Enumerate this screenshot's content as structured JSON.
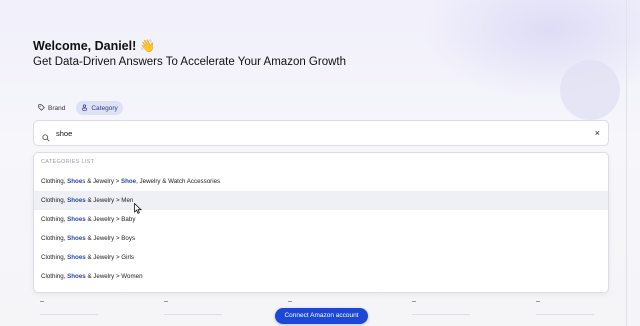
{
  "header": {
    "welcome": "Welcome, Daniel! 👋",
    "subtitle": "Get Data-Driven Answers To Accelerate Your Amazon Growth"
  },
  "tabs": [
    {
      "label": "Brand",
      "icon": "tag-icon",
      "active": false
    },
    {
      "label": "Category",
      "icon": "category-icon",
      "active": true
    }
  ],
  "search": {
    "value": "shoe",
    "placeholder": "",
    "clear_label": "×"
  },
  "dropdown": {
    "header": "CATEGORIES LIST",
    "items": [
      {
        "prefix": "Clothing, ",
        "match": "Shoe",
        "suffix": "s & Jewelry > ",
        "match2": "Shoe",
        "suffix2": ", Jewelry & Watch Accessories"
      },
      {
        "prefix": "Clothing, ",
        "match": "Shoes",
        "suffix": " & Jewelry > Men"
      },
      {
        "prefix": "Clothing, ",
        "match": "Shoes",
        "suffix": " & Jewelry > Baby"
      },
      {
        "prefix": "Clothing, ",
        "match": "Shoes",
        "suffix": " & Jewelry > Boys"
      },
      {
        "prefix": "Clothing, ",
        "match": "Shoes",
        "suffix": " & Jewelry > Girls"
      },
      {
        "prefix": "Clothing, ",
        "match": "Shoes",
        "suffix": " & Jewelry > Women"
      }
    ],
    "hovered_index": 1
  },
  "cta": {
    "label": "Connect Amazon account"
  },
  "colors": {
    "accent": "#1f47d6",
    "match": "#2c47a8",
    "active_pill_bg": "#dde2f6"
  }
}
